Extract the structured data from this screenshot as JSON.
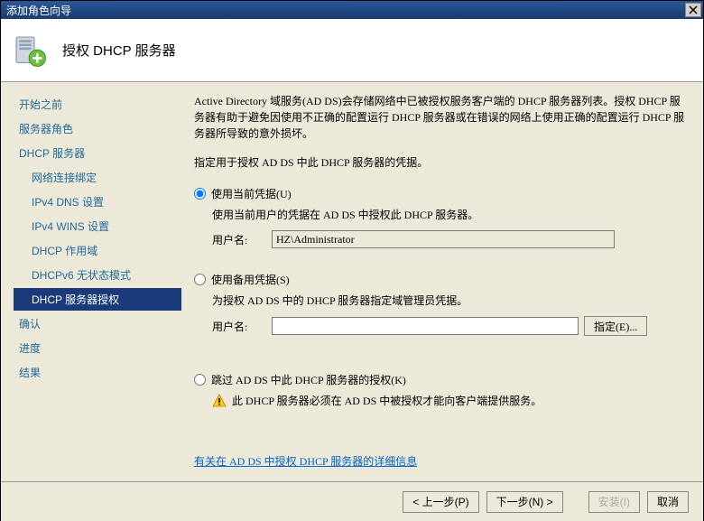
{
  "window": {
    "title": "添加角色向导"
  },
  "header": {
    "title": "授权 DHCP 服务器"
  },
  "sidebar": {
    "items": [
      "开始之前",
      "服务器角色",
      "DHCP 服务器",
      "网络连接绑定",
      "IPv4 DNS 设置",
      "IPv4 WINS 设置",
      "DHCP 作用域",
      "DHCPv6 无状态模式",
      "DHCP 服务器授权",
      "确认",
      "进度",
      "结果"
    ]
  },
  "content": {
    "description": "Active Directory 域服务(AD DS)会存储网络中已被授权服务客户端的 DHCP 服务器列表。授权 DHCP 服务器有助于避免因使用不正确的配置运行 DHCP 服务器或在错误的网络上使用正确的配置运行 DHCP 服务器所导致的意外损坏。",
    "instruction": "指定用于授权 AD DS 中此 DHCP 服务器的凭据。",
    "options": [
      {
        "label": "使用当前凭据(U)",
        "desc": "使用当前用户的凭据在 AD DS 中授权此 DHCP 服务器。",
        "user_label": "用户名:",
        "user_value": "HZ\\Administrator"
      },
      {
        "label": "使用备用凭据(S)",
        "desc": "为授权 AD DS 中的 DHCP 服务器指定域管理员凭据。",
        "user_label": "用户名:",
        "user_value": "",
        "specify_btn": "指定(E)..."
      },
      {
        "label": "跳过 AD DS 中此 DHCP 服务器的授权(K)",
        "warn": "此 DHCP 服务器必须在 AD DS 中被授权才能向客户端提供服务。"
      }
    ],
    "help_link": "有关在 AD DS 中授权 DHCP 服务器的详细信息"
  },
  "footer": {
    "prev": "< 上一步(P)",
    "next": "下一步(N) >",
    "install": "安装(I)",
    "cancel": "取消"
  }
}
